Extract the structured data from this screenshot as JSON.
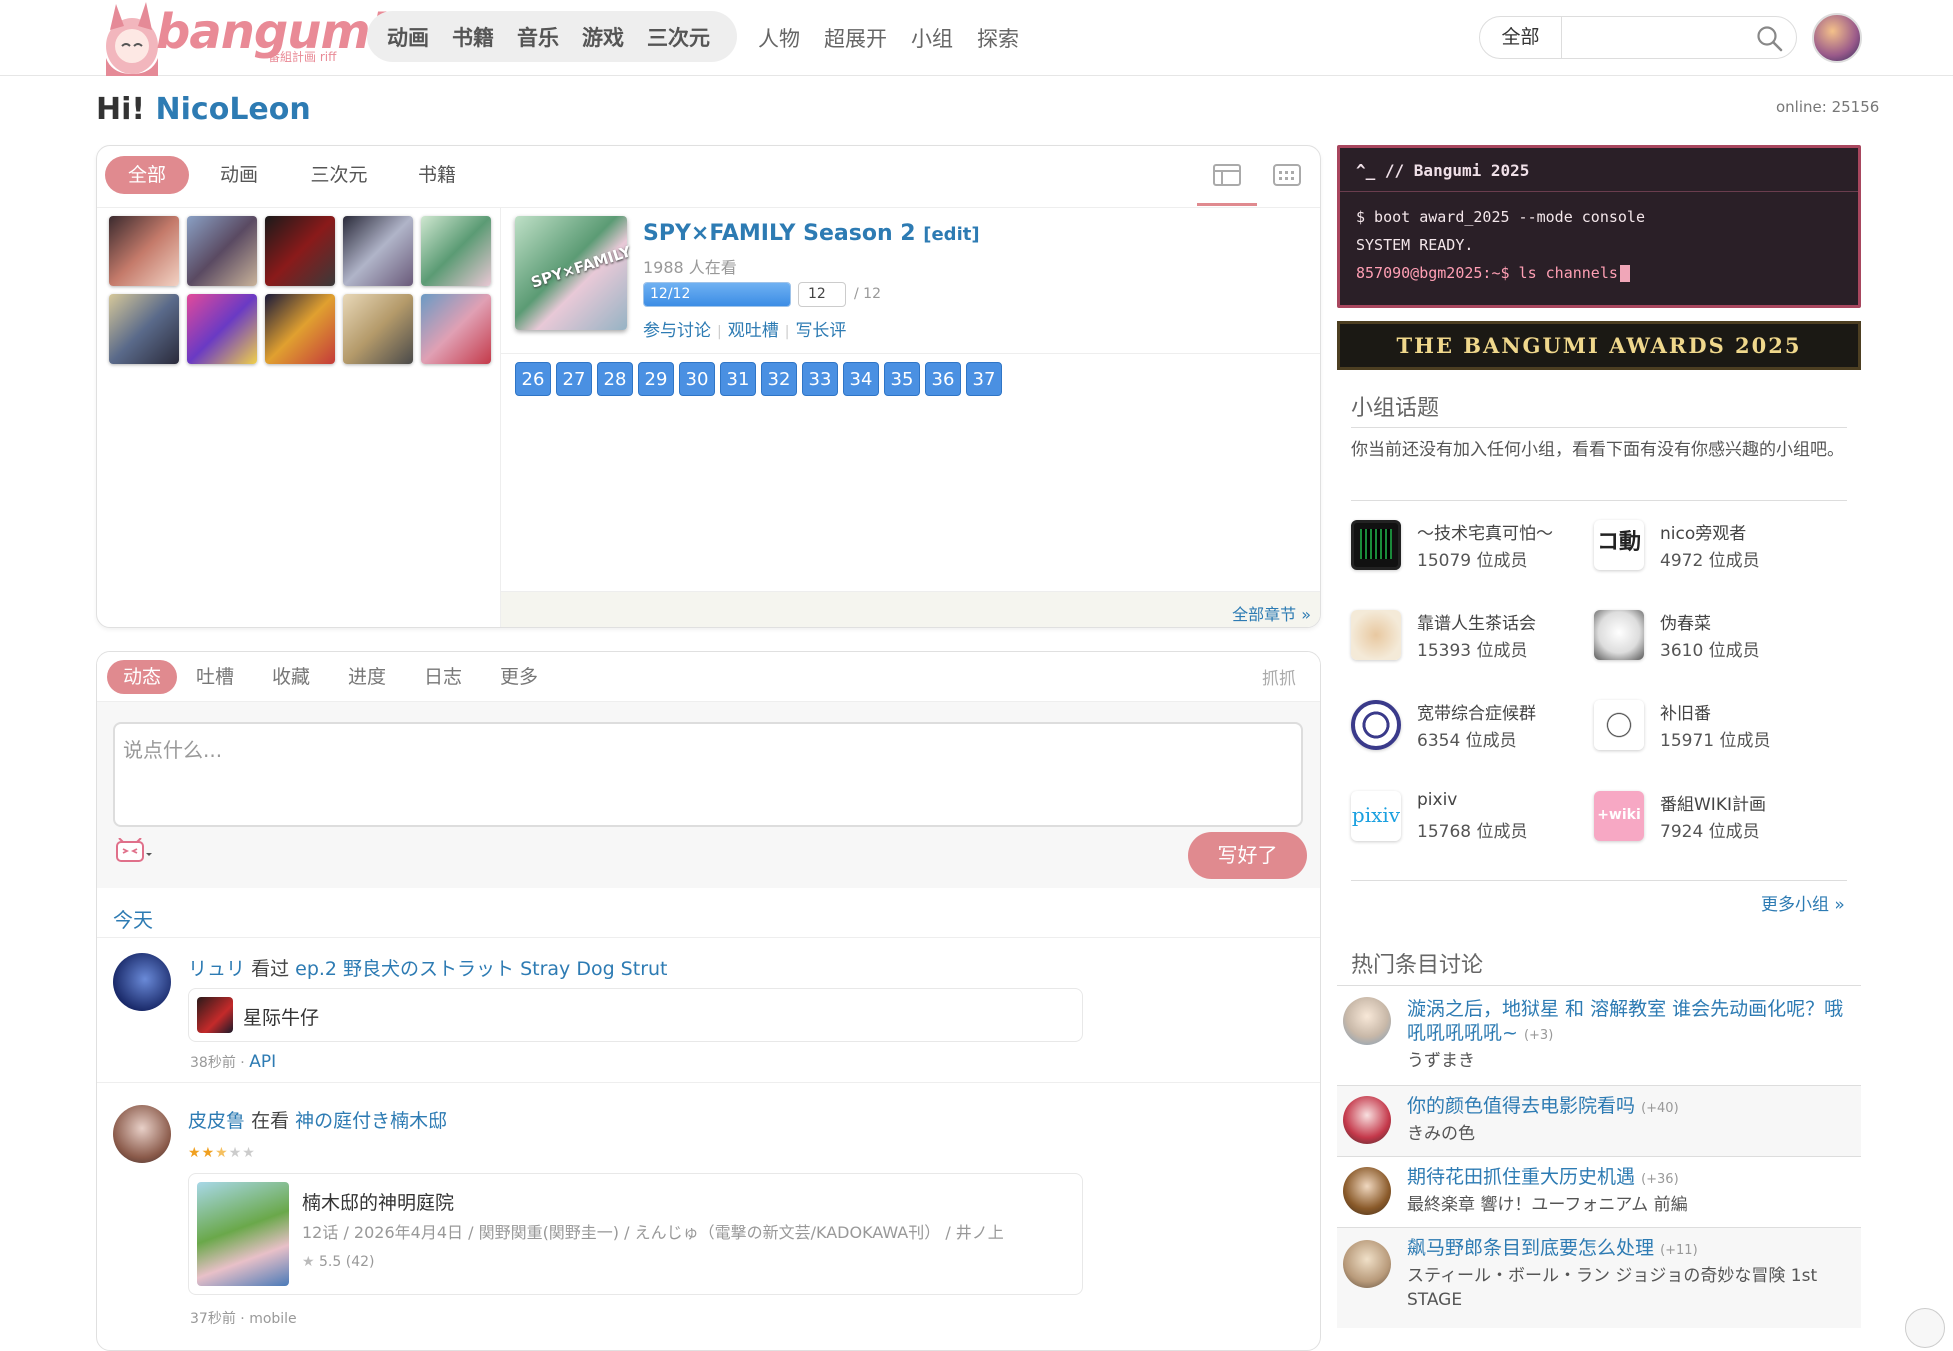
{
  "header": {
    "logo_text": "bangumi",
    "logo_sub": "番組計画 riff",
    "nav_main": [
      "动画",
      "书籍",
      "音乐",
      "游戏",
      "三次元"
    ],
    "nav_secondary": [
      "人物",
      "超展开",
      "小组",
      "探索"
    ],
    "search": {
      "category": "全部",
      "placeholder": ""
    }
  },
  "greeting": {
    "hi": "Hi!",
    "user": "NicoLeon",
    "online": "online: 25156"
  },
  "progress_panel": {
    "tabs": [
      "全部",
      "动画",
      "三次元",
      "书籍"
    ],
    "subject": {
      "title": "SPY×FAMILY Season 2",
      "edit": "[edit]",
      "watching": "1988 人在看",
      "progress_label": "12/12",
      "progress_fraction": 1.0,
      "ep_input": "12",
      "ep_total": "/ 12",
      "links": [
        "参与讨论",
        "观吐槽",
        "写长评"
      ],
      "cover_text": "SPY×FAMILY"
    },
    "episodes": [
      "26",
      "27",
      "28",
      "29",
      "30",
      "31",
      "32",
      "33",
      "34",
      "35",
      "36",
      "37"
    ],
    "all_episodes": "全部章节 »",
    "view_switch": [
      "☰",
      "≡",
      "▦"
    ]
  },
  "timeline": {
    "tabs": [
      "动态",
      "吐槽",
      "收藏",
      "进度",
      "日志",
      "更多"
    ],
    "grab": "抓抓",
    "placeholder": "说点什么...",
    "submit": "写好了",
    "today": "今天",
    "items": [
      {
        "user": "リュリ",
        "action": "看过",
        "target": "ep.2 野良犬のストラット Stray Dog Strut",
        "card_title": "星际牛仔",
        "time": "38秒前",
        "source": "API"
      },
      {
        "user": "皮皮鲁",
        "action": "在看",
        "target": "神の庭付き楠木邸",
        "rating": 2.5,
        "card_title": "楠木邸的神明庭院",
        "card_info": "12话 / 2026年4月4日 / 関野関重(関野圭一) / えんじゅ（電撃の新文芸/KADOKAWA刊） / 井ノ上",
        "card_score": "5.5 (42)",
        "time": "37秒前",
        "source": "mobile"
      }
    ]
  },
  "sidebar": {
    "terminal": {
      "title": "^_ // Bangumi 2025",
      "line1": "$ boot award_2025 --mode console",
      "line2": "SYSTEM READY.",
      "prompt": "857090@bgm2025:~$ ls channels"
    },
    "award_banner": "THE BANGUMI AWARDS 2025",
    "groups_title": "小组话题",
    "groups_tip": "你当前还没有加入任何小组，看看下面有没有你感兴趣的小组吧。",
    "groups": [
      {
        "name": "～技术宅真可怕～",
        "members": "15079 位成员"
      },
      {
        "name": "nico旁观者",
        "members": "4972 位成员"
      },
      {
        "name": "靠谱人生茶话会",
        "members": "15393 位成员"
      },
      {
        "name": "伪春菜",
        "members": "3610 位成员"
      },
      {
        "name": "宽带综合症候群",
        "members": "6354 位成员"
      },
      {
        "name": "补旧番",
        "members": "15971 位成员"
      },
      {
        "name": "pixiv",
        "members": "15768 位成员"
      },
      {
        "name": "番組WIKI計画",
        "members": "7924 位成员"
      }
    ],
    "more_groups": "更多小组 »",
    "hot_title": "热门条目讨论",
    "hot": [
      {
        "title": "漩涡之后，地狱星 和 溶解教室 谁会先动画化呢？哦吼吼吼吼吼~",
        "count": "(+3)",
        "subject": "うずまき"
      },
      {
        "title": "你的颜色值得去电影院看吗",
        "count": "(+40)",
        "subject": "きみの色"
      },
      {
        "title": "期待花田抓住重大历史机遇",
        "count": "(+36)",
        "subject": "最終楽章 響け！ユーフォニアム 前編"
      },
      {
        "title": "飙马野郎条目到底要怎么处理",
        "count": "(+11)",
        "subject": "スティール・ボール・ラン ジョジョの奇妙な冒険 1st STAGE"
      }
    ]
  },
  "colors": {
    "accent": "#e08a8f",
    "link": "#2d7bb3",
    "episode": "#4a90e2"
  }
}
